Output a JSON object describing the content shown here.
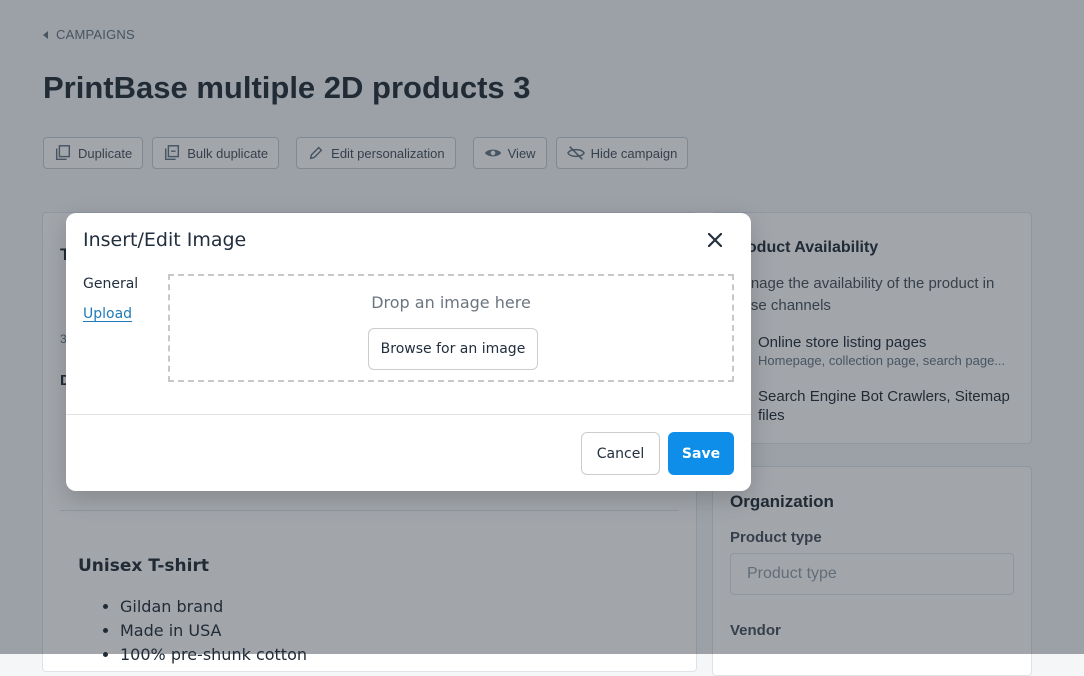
{
  "breadcrumb": {
    "label": "CAMPAIGNS"
  },
  "page": {
    "title": "PrintBase multiple 2D products 3"
  },
  "actions": {
    "duplicate": "Duplicate",
    "bulk_duplicate": "Bulk duplicate",
    "edit_personalization": "Edit personalization",
    "view": "View",
    "hide_campaign": "Hide campaign"
  },
  "left_card": {
    "peek_title": "T",
    "peek_count": "3",
    "peek_desc": "D",
    "editor": {
      "heading": "Unisex T-shirt",
      "bullets": [
        "Gildan brand",
        "Made in USA",
        "100% pre-shunk cotton"
      ]
    }
  },
  "availability": {
    "title": "Product Availability",
    "description": "Manage the availability of the product in these channels",
    "items": [
      {
        "label": "Online store listing pages",
        "sub": "Homepage, collection page, search page..."
      },
      {
        "label": "Search Engine Bot Crawlers, Sitemap files",
        "sub": ""
      }
    ]
  },
  "organization": {
    "title": "Organization",
    "product_type_label": "Product type",
    "product_type_placeholder": "Product type",
    "vendor_label": "Vendor"
  },
  "modal": {
    "title": "Insert/Edit Image",
    "tabs": [
      "General",
      "Upload"
    ],
    "active_tab": "Upload",
    "drop_text": "Drop an image here",
    "browse_label": "Browse for an image",
    "cancel_label": "Cancel",
    "save_label": "Save"
  },
  "colors": {
    "primary": "#0e8ee9",
    "link": "#207ab7",
    "overlay": "rgba(33,43,54,0.42)"
  }
}
